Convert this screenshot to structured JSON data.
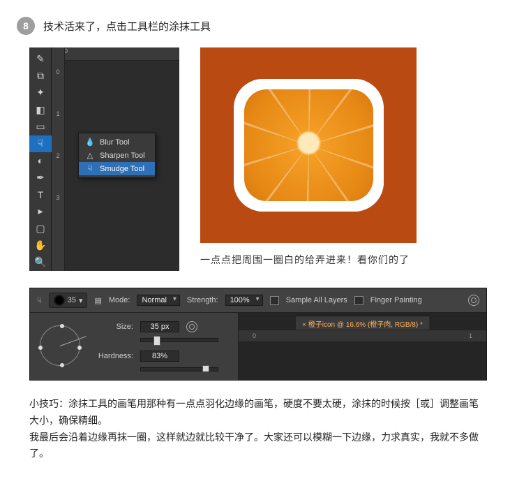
{
  "step": {
    "number": "8",
    "title": "技术活来了，点击工具栏的涂抹工具"
  },
  "toolbar": {
    "ruler_top_zero": "0",
    "ruler_left_marks": [
      "0",
      "1",
      "2",
      "3"
    ],
    "flyout": {
      "blur": "Blur Tool",
      "sharpen": "Sharpen Tool",
      "smudge": "Smudge Tool"
    }
  },
  "orange": {
    "caption": "一点点把周围一圈白的给弄进来！看你们的了"
  },
  "options": {
    "brush_size_chip": "35",
    "mode_label": "Mode:",
    "mode_value": "Normal",
    "strength_label": "Strength:",
    "strength_value": "100%",
    "sample_all": "Sample All Layers",
    "finger_paint": "Finger Painting",
    "size_label": "Size:",
    "size_value": "35 px",
    "hardness_label": "Hardness:",
    "hardness_value": "83%",
    "doc_tab": "× 橙子icon @ 16.6% (橙子肉, RGB/8) *",
    "ruler_a": "0",
    "ruler_b": "1"
  },
  "tip": {
    "line1": "小技巧：涂抹工具的画笔用那种有一点点羽化边缘的画笔，硬度不要太硬，涂抹的时候按［或］调整画笔大小，确保精细。",
    "line2": "我最后会沿着边缘再抹一圈，这样就边就比较干净了。大家还可以模糊一下边缘，力求真实，我就不多做了。"
  }
}
